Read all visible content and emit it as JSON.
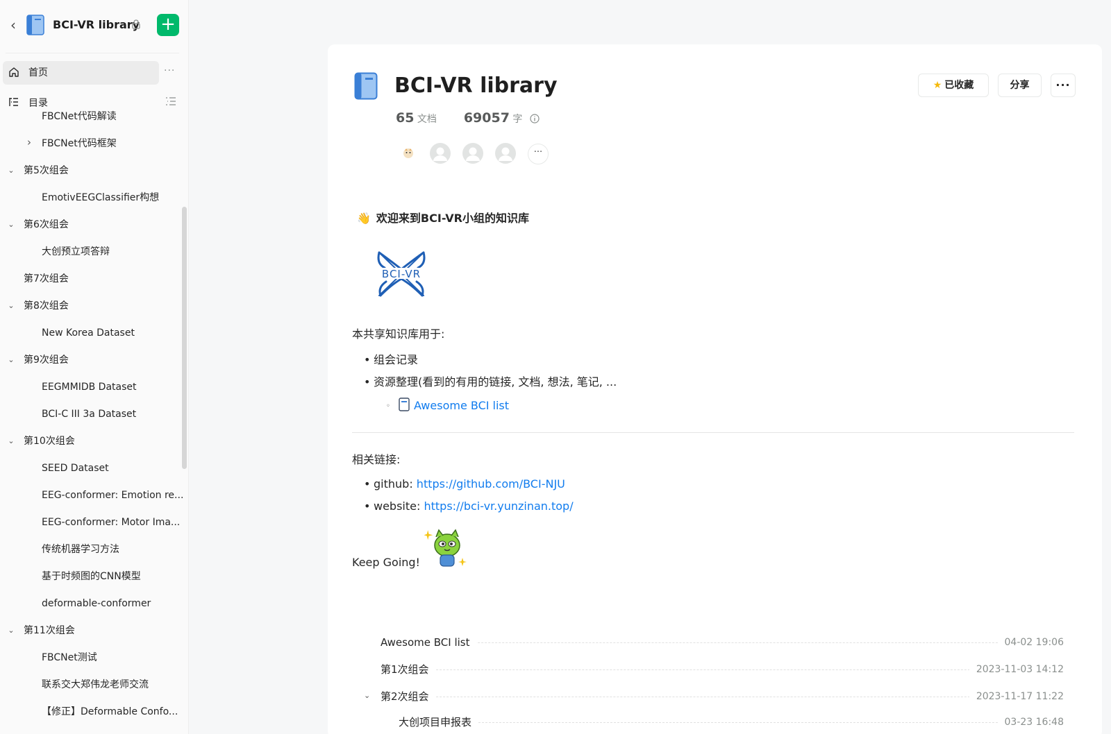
{
  "sidebar": {
    "title": "BCI-VR library",
    "home_label": "首页",
    "toc_label": "目录",
    "items": [
      {
        "label": "FBCNet代码解读",
        "level": 2,
        "caret": ""
      },
      {
        "label": "FBCNet代码框架",
        "level": 2,
        "caret": "›"
      },
      {
        "label": "第5次组会",
        "level": 1,
        "caret": "⌄"
      },
      {
        "label": "EmotivEEGClassifier构想",
        "level": 2,
        "caret": ""
      },
      {
        "label": "第6次组会",
        "level": 1,
        "caret": "⌄"
      },
      {
        "label": "大创预立项答辩",
        "level": 2,
        "caret": ""
      },
      {
        "label": "第7次组会",
        "level": 1,
        "caret": ""
      },
      {
        "label": "第8次组会",
        "level": 1,
        "caret": "⌄"
      },
      {
        "label": "New Korea Dataset",
        "level": 2,
        "caret": ""
      },
      {
        "label": "第9次组会",
        "level": 1,
        "caret": "⌄"
      },
      {
        "label": "EEGMMIDB Dataset",
        "level": 2,
        "caret": ""
      },
      {
        "label": "BCI-C III 3a Dataset",
        "level": 2,
        "caret": ""
      },
      {
        "label": "第10次组会",
        "level": 1,
        "caret": "⌄"
      },
      {
        "label": "SEED Dataset",
        "level": 2,
        "caret": ""
      },
      {
        "label": "EEG-conformer: Emotion re...",
        "level": 2,
        "caret": ""
      },
      {
        "label": "EEG-conformer: Motor Ima...",
        "level": 2,
        "caret": ""
      },
      {
        "label": "传统机器学习方法",
        "level": 2,
        "caret": ""
      },
      {
        "label": "基于时频图的CNN模型",
        "level": 2,
        "caret": ""
      },
      {
        "label": "deformable-conformer",
        "level": 2,
        "caret": ""
      },
      {
        "label": "第11次组会",
        "level": 1,
        "caret": "⌄"
      },
      {
        "label": "FBCNet测试",
        "level": 2,
        "caret": ""
      },
      {
        "label": "联系交大郑伟龙老师交流",
        "level": 2,
        "caret": ""
      },
      {
        "label": "【修正】Deformable Confo...",
        "level": 2,
        "caret": ""
      }
    ]
  },
  "header": {
    "title": "BCI-VR library",
    "doc_count": "65",
    "doc_unit": "文档",
    "word_count": "69057",
    "word_unit": "字",
    "fav_label": "已收藏",
    "share_label": "分享",
    "more_label": "···",
    "avatars_more": "···"
  },
  "content": {
    "welcome_emoji": "👋",
    "welcome_text": "欢迎来到BCI-VR小组的知识库",
    "intro": "本共享知识库用于:",
    "bullets": [
      "组会记录",
      "资源整理(看到的有用的链接, 文档, 想法, 笔记, ..."
    ],
    "sub_link": "Awesome BCI list",
    "links_title": "相关链接:",
    "github_label": "github: ",
    "github_url": "https://github.com/BCI-NJU",
    "website_label": "website: ",
    "website_url": "https://bci-vr.yunzinan.top/",
    "keep_going": "Keep Going!"
  },
  "catalog": [
    {
      "title": "Awesome BCI list",
      "date": "04-02 19:06",
      "caret": ""
    },
    {
      "title": "第1次组会",
      "date": "2023-11-03 14:12",
      "caret": ""
    },
    {
      "title": "第2次组会",
      "date": "2023-11-17 11:22",
      "caret": "⌄"
    },
    {
      "title": "大创项目申报表",
      "date": "03-23 16:48",
      "caret": ""
    }
  ],
  "colors": {
    "accent_green": "#00b96b",
    "link_blue": "#117cee",
    "star_yellow": "#f5b90b"
  }
}
